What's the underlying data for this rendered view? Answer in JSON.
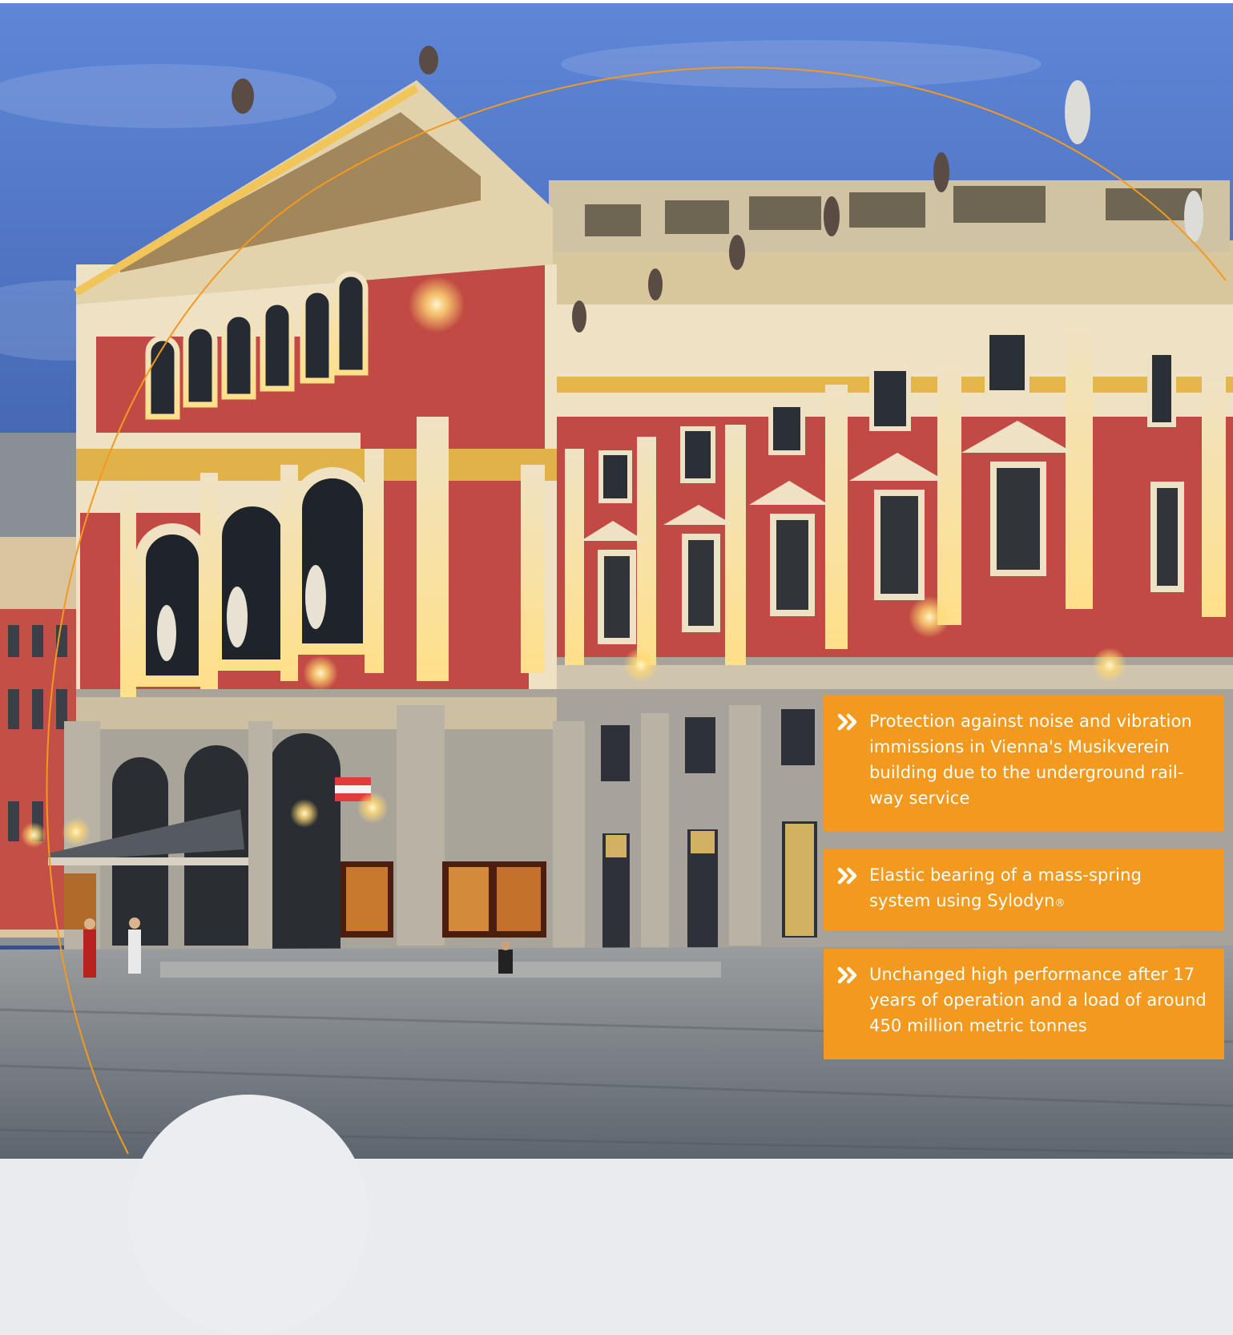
{
  "photo": {
    "subject": "Vienna Musikverein building at dusk",
    "sky_color": "#3f5fa8",
    "facade_red": "#c14b44",
    "facade_cream": "#efe2c4",
    "light_glow": "#ffd873",
    "ground": "#7f868e"
  },
  "brand": {
    "accent": "#f39a1e",
    "arc_color": "#f39a1e",
    "text_on_accent": "#ffffff"
  },
  "callouts": [
    {
      "icon": "double-chevron-right-icon",
      "text": "Protection against noise and vibration immissions in Vienna's Musikverein building due to the underground rail-way service"
    },
    {
      "icon": "double-chevron-right-icon",
      "text": "Elastic bearing of a mass-spring system using Sylodyn",
      "suffix": "®"
    },
    {
      "icon": "double-chevron-right-icon",
      "text": "Unchanged high performance after 17 years of operation and a load of around 450 million metric tonnes"
    }
  ]
}
